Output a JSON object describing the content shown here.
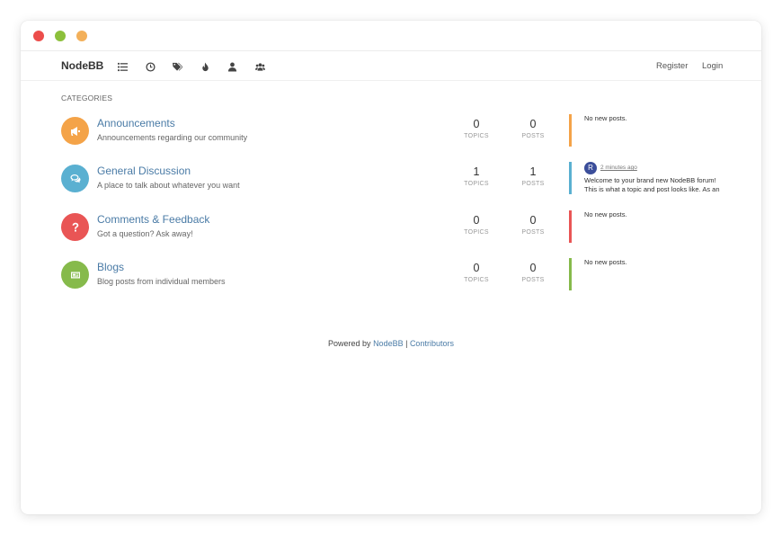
{
  "navbar": {
    "brand": "NodeBB",
    "icons": [
      "list-icon",
      "clock-icon",
      "tags-icon",
      "fire-icon",
      "user-icon",
      "users-icon"
    ],
    "register_label": "Register",
    "login_label": "Login"
  },
  "categories_heading": "CATEGORIES",
  "categories": [
    {
      "title": "Announcements",
      "description": "Announcements regarding our community",
      "icon": "bullhorn-icon",
      "color": "#f4a348",
      "topics": "0",
      "posts": "0",
      "topics_label": "TOPICS",
      "posts_label": "POSTS",
      "last_post": "No new posts."
    },
    {
      "title": "General Discussion",
      "description": "A place to talk about whatever you want",
      "icon": "comments-icon",
      "color": "#5ab0d1",
      "topics": "1",
      "posts": "1",
      "topics_label": "TOPICS",
      "posts_label": "POSTS",
      "last_post_avatar": "R",
      "last_post_time": "2 minutes ago",
      "last_post_line1": "Welcome to your brand new NodeBB forum!",
      "last_post_line2": "This is what a topic and post looks like. As an"
    },
    {
      "title": "Comments & Feedback",
      "description": "Got a question? Ask away!",
      "icon": "question-icon",
      "color": "#e95555",
      "topics": "0",
      "posts": "0",
      "topics_label": "TOPICS",
      "posts_label": "POSTS",
      "last_post": "No new posts."
    },
    {
      "title": "Blogs",
      "description": "Blog posts from individual members",
      "icon": "newspaper-icon",
      "color": "#86ba4b",
      "topics": "0",
      "posts": "0",
      "topics_label": "TOPICS",
      "posts_label": "POSTS",
      "last_post": "No new posts."
    }
  ],
  "footer": {
    "powered_by": "Powered by ",
    "nodebb_link": "NodeBB",
    "separator": " | ",
    "contributors_link": "Contributors"
  }
}
